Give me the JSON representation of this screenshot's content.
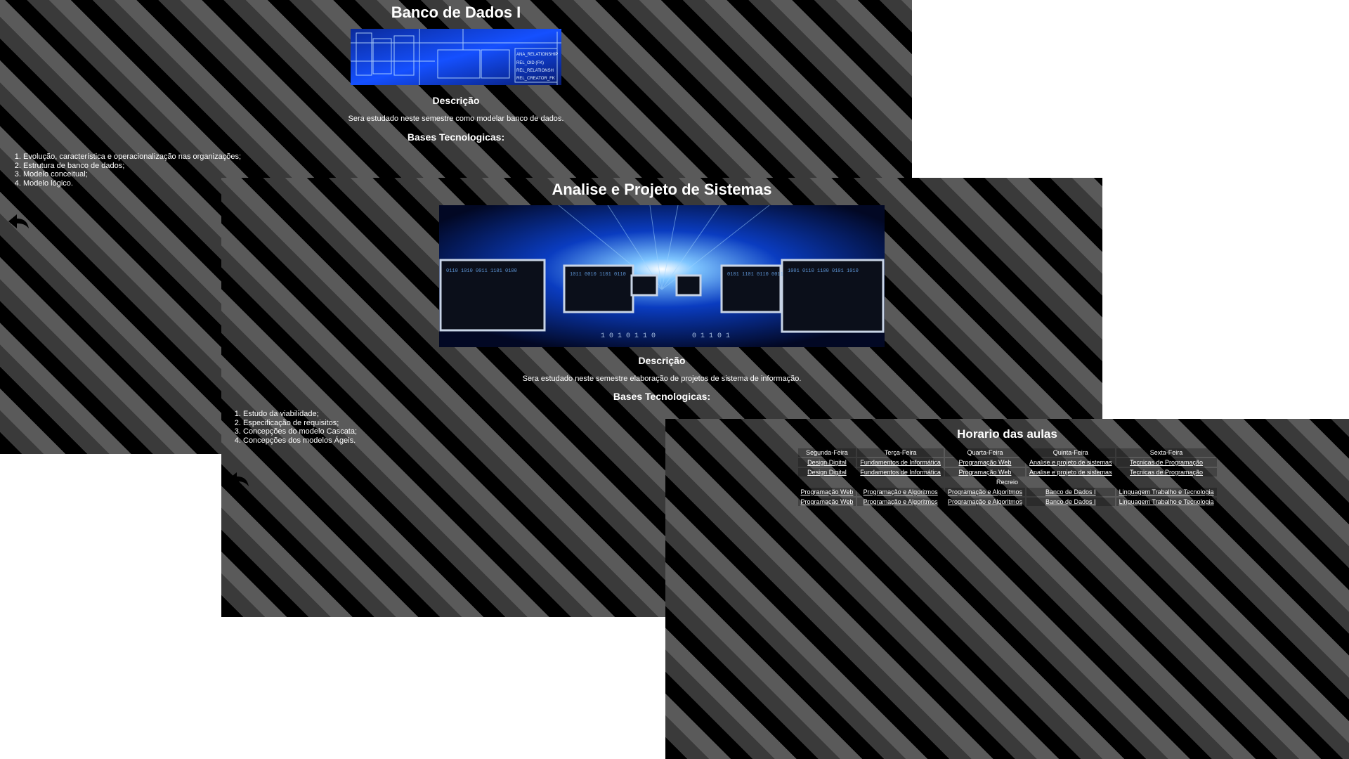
{
  "banco_de_dados": {
    "title": "Banco de Dados I",
    "descricao_heading": "Descrição",
    "descricao": "Sera estudado neste semestre como modelar banco de dados.",
    "bases_heading": "Bases Tecnologicas:",
    "topics": [
      "Evolução, característica e operacionalização nas organizações;",
      "Estrutura de banco de dados;",
      "Modelo conceitual;",
      "Modelo lógico."
    ],
    "banner_labels": [
      "ANA_RELATIONSHIP",
      "REL_OID (FK)",
      "REL_RELATIONSH",
      "REL_CREATOR_FK"
    ]
  },
  "analise_projeto": {
    "title": "Analise e Projeto de Sistemas",
    "descricao_heading": "Descrição",
    "descricao": "Sera estudado neste semestre elaboração de projetos de sistema de informação.",
    "bases_heading": "Bases Tecnologicas:",
    "topics": [
      "Estudo da viabilidade;",
      "Especificação de requisitos;",
      "Concepções do modelo Cascata;",
      "Concepções dos modelos Ágeis."
    ]
  },
  "horario": {
    "title": "Horario das aulas",
    "days": [
      "Segunda-Feira",
      "Terça-Feira",
      "Quarta-Feira",
      "Quinta-Feira",
      "Sexta-Feira"
    ],
    "rows_before": [
      [
        "Design Digital",
        "Fundamentos de Informática",
        "Programação Web",
        "Analise e projeto de sistemas",
        "Tecnicas de Programação"
      ],
      [
        "Design Digital",
        "Fundamentos de Informática",
        "Programação Web",
        "Analise e projeto de sistemas",
        "Tecnicas de Programação"
      ]
    ],
    "recreio": "Recreio",
    "rows_after": [
      [
        "Programação Web",
        "Programação e Algoritmos",
        "Programação e Algoritmos",
        "Banco de Dados I",
        "Linguagem Trabalho e Tecnologia"
      ],
      [
        "Programação Web",
        "Programação e Algoritmos",
        "Programação e Algoritmos",
        "Banco de Dados I",
        "Linguagem Trabalho e Tecnologia"
      ]
    ]
  },
  "icons": {
    "back": "back-arrow-icon"
  }
}
